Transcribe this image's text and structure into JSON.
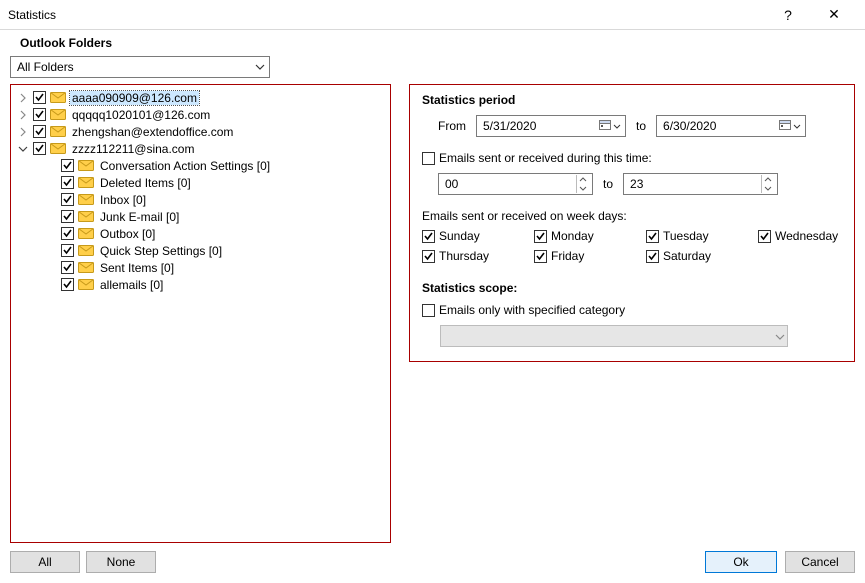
{
  "titlebar": {
    "title": "Statistics",
    "help": "?",
    "close": "✕"
  },
  "outlook_folders_label": "Outlook Folders",
  "folder_dropdown": {
    "selected": "All Folders"
  },
  "buttons": {
    "all": "All",
    "none": "None",
    "ok": "Ok",
    "cancel": "Cancel"
  },
  "tree": {
    "accounts": [
      {
        "label": "aaaa090909@126.com",
        "expanded": false,
        "checked": true,
        "selected": true
      },
      {
        "label": "qqqqq1020101@126.com",
        "expanded": false,
        "checked": true,
        "selected": false
      },
      {
        "label": "zhengshan@extendoffice.com",
        "expanded": false,
        "checked": true,
        "selected": false
      },
      {
        "label": "zzzz112211@sina.com",
        "expanded": true,
        "checked": true,
        "selected": false,
        "children": [
          {
            "label": "Conversation Action Settings [0]",
            "checked": true
          },
          {
            "label": "Deleted Items [0]",
            "checked": true
          },
          {
            "label": "Inbox [0]",
            "checked": true
          },
          {
            "label": "Junk E-mail [0]",
            "checked": true
          },
          {
            "label": "Outbox [0]",
            "checked": true
          },
          {
            "label": "Quick Step Settings [0]",
            "checked": true
          },
          {
            "label": "Sent Items [0]",
            "checked": true
          },
          {
            "label": "allemails [0]",
            "checked": true
          }
        ]
      }
    ]
  },
  "stats_period": {
    "title": "Statistics period",
    "from_label": "From",
    "from_value": "5/31/2020",
    "to_label": "to",
    "to_value": "6/30/2020",
    "time_filter_label": "Emails sent or received during this time:",
    "time_filter_checked": false,
    "time_from": "00",
    "time_to_label": "to",
    "time_to": "23",
    "weekdays_label": "Emails sent or received on week days:",
    "weekdays": {
      "sunday": {
        "label": "Sunday",
        "checked": true
      },
      "monday": {
        "label": "Monday",
        "checked": true
      },
      "tuesday": {
        "label": "Tuesday",
        "checked": true
      },
      "wednesday": {
        "label": "Wednesday",
        "checked": true
      },
      "thursday": {
        "label": "Thursday",
        "checked": true
      },
      "friday": {
        "label": "Friday",
        "checked": true
      },
      "saturday": {
        "label": "Saturday",
        "checked": true
      }
    }
  },
  "stats_scope": {
    "title": "Statistics scope:",
    "category_label": "Emails only with specified category",
    "category_checked": false
  }
}
